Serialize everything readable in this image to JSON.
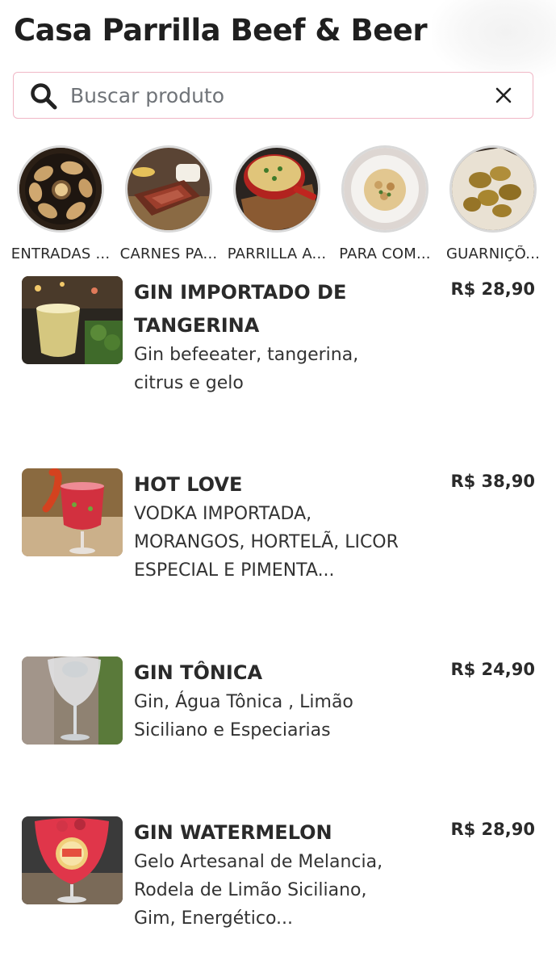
{
  "header": {
    "title": "Casa Parrilla Beef & Beer"
  },
  "search": {
    "placeholder": "Buscar produto",
    "value": ""
  },
  "categories": [
    {
      "label": "ENTRADAS ...",
      "icon": "appetizer-photo"
    },
    {
      "label": "CARNES PA...",
      "icon": "steak-photo"
    },
    {
      "label": "PARRILLA A...",
      "icon": "pan-dish-photo"
    },
    {
      "label": "PARA COM...",
      "icon": "risotto-photo"
    },
    {
      "label": "GUARNIÇÕ...",
      "icon": "side-dish-photo"
    }
  ],
  "products": [
    {
      "name": "GIN IMPORTADO DE TANGERINA",
      "description": "Gin befeeater, tangerina, citrus e gelo",
      "price": "R$ 28,90"
    },
    {
      "name": "HOT LOVE",
      "description": "VODKA IMPORTADA, MORANGOS, HORTELÃ, LICOR ESPECIAL E PIMENTA...",
      "price": "R$ 38,90"
    },
    {
      "name": "GIN TÔNICA",
      "description": "Gin, Água Tônica , Limão Siciliano e Especiarias",
      "price": "R$ 24,90"
    },
    {
      "name": "GIN WATERMELON",
      "description": "Gelo Artesanal de Melancia, Rodela de Limão Siciliano, Gim, Energético...",
      "price": "R$ 28,90"
    }
  ],
  "colors": {
    "search_border": "#f0b7c6",
    "text": "#2a2a2a",
    "category_ring": "#d9d9d9"
  }
}
